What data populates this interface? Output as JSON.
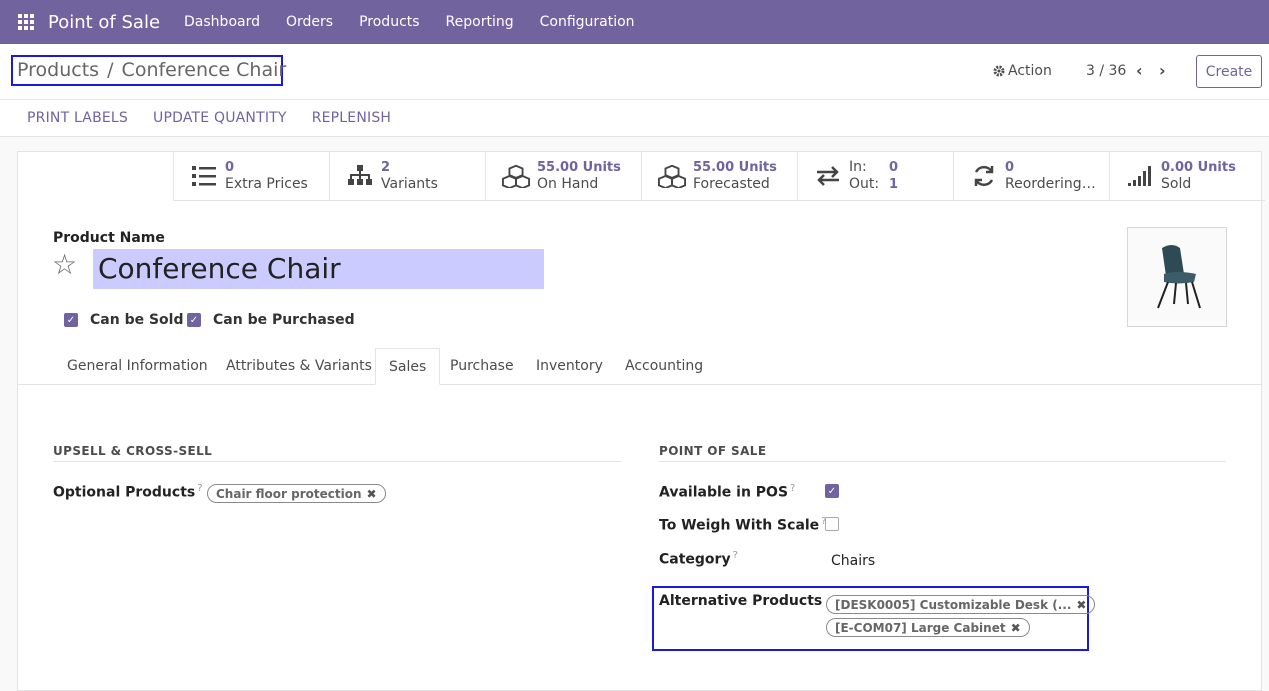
{
  "topbar": {
    "brand": "Point of Sale",
    "menu": [
      "Dashboard",
      "Orders",
      "Products",
      "Reporting",
      "Configuration"
    ]
  },
  "breadcrumb": {
    "parent": "Products",
    "separator": "/",
    "current": "Conference Chair"
  },
  "control": {
    "action_label": "Action",
    "pager": "3 / 36",
    "create_label": "Create"
  },
  "statusbar": {
    "buttons": [
      "PRINT LABELS",
      "UPDATE QUANTITY",
      "REPLENISH"
    ]
  },
  "stats": {
    "extra_prices": {
      "value": "0",
      "label": "Extra Prices"
    },
    "variants": {
      "value": "2",
      "label": "Variants"
    },
    "on_hand": {
      "value": "55.00 Units",
      "label": "On Hand"
    },
    "forecasted": {
      "value": "55.00 Units",
      "label": "Forecasted"
    },
    "in_label": "In:",
    "in_value": "0",
    "out_label": "Out:",
    "out_value": "1",
    "reordering": {
      "value": "0",
      "label": "Reordering…"
    },
    "sold": {
      "value": "0.00 Units",
      "label": "Sold"
    }
  },
  "product": {
    "name_label": "Product Name",
    "name": "Conference Chair",
    "can_be_sold": "Can be Sold",
    "can_be_purchased": "Can be Purchased"
  },
  "tabs": [
    "General Information",
    "Attributes & Variants",
    "Sales",
    "Purchase",
    "Inventory",
    "Accounting"
  ],
  "active_tab": "Sales",
  "upsell": {
    "title": "UPSELL & CROSS-SELL",
    "optional_label": "Optional Products",
    "optional_tags": [
      "Chair floor protection"
    ]
  },
  "pos": {
    "title": "POINT OF SALE",
    "available_label": "Available in POS",
    "available": true,
    "weigh_label": "To Weigh With Scale",
    "weigh": false,
    "category_label": "Category",
    "category_value": "Chairs",
    "alt_label": "Alternative Products",
    "alt_tags": [
      "[DESK0005] Customizable Desk (...",
      "[E-COM07] Large Cabinet"
    ]
  },
  "colors": {
    "brand": "#71639e",
    "highlight_box": "#1a1adb",
    "name_bg": "#cccbff"
  }
}
